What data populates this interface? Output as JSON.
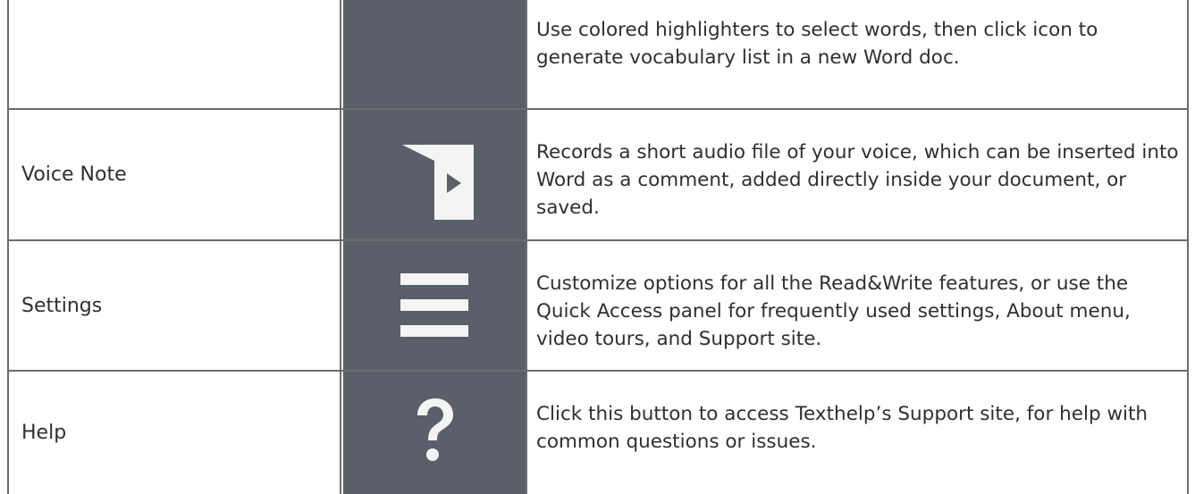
{
  "rows": [
    {
      "name": "",
      "icon": "vocabulary-icon",
      "description": "Use colored highlighters to select words, then click icon to generate vocabulary list in a new Word doc."
    },
    {
      "name": "Voice Note",
      "icon": "voice-note-icon",
      "description": "Records a short audio file of your voice, which can be inserted into Word as a comment, added directly inside your document, or saved."
    },
    {
      "name": "Settings",
      "icon": "hamburger-menu-icon",
      "description": "Customize options for all the Read&Write features, or use the Quick Access panel for frequently used settings, About menu, video tours, and Support site."
    },
    {
      "name": "Help",
      "icon": "question-mark-icon",
      "description": "Click this button to access Texthelp’s Support site, for help with common questions or issues."
    }
  ],
  "colors": {
    "icon_background": "#5b5f69",
    "icon_foreground": "#ffffff",
    "border": "#6b6b6b",
    "text": "#2f2f2f"
  }
}
